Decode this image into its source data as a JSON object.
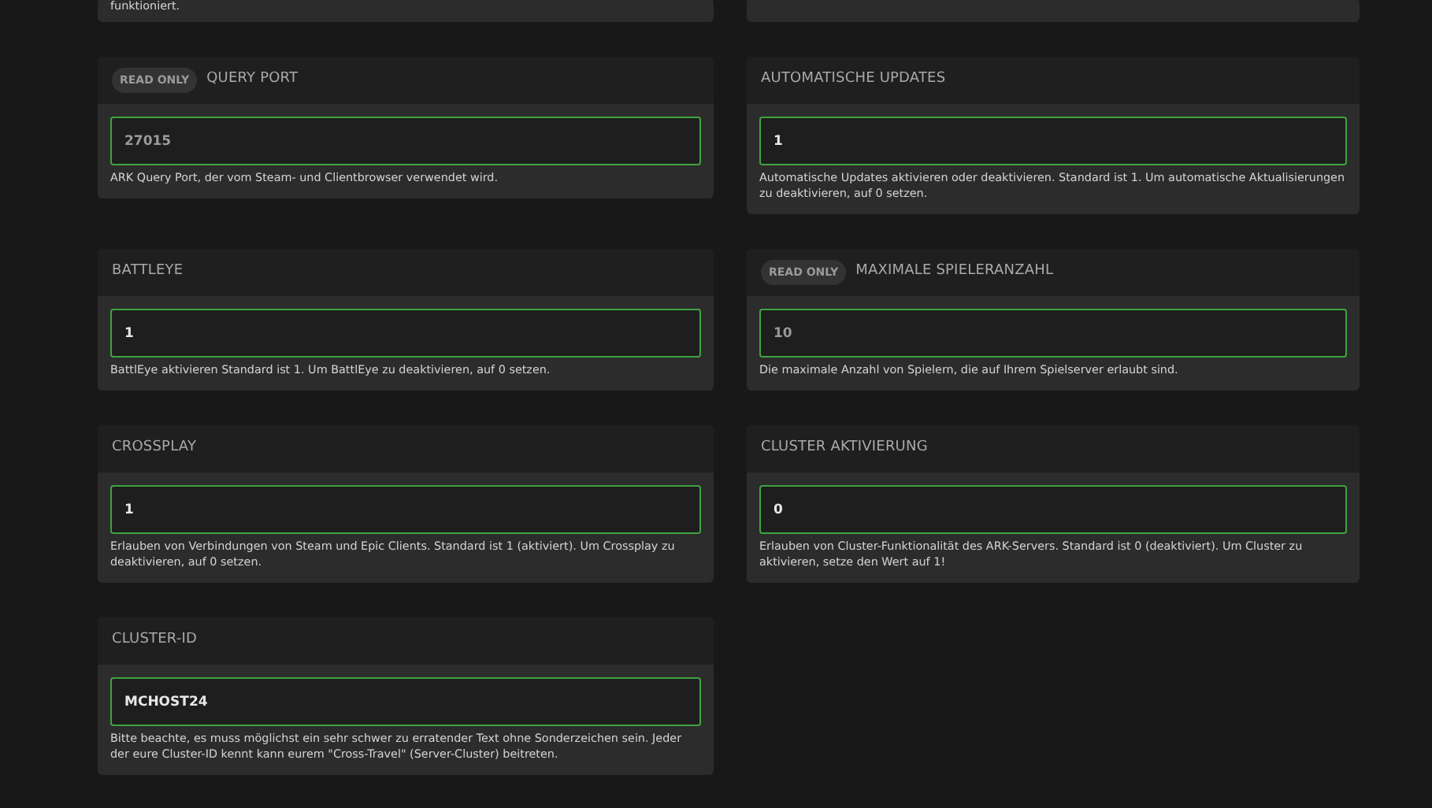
{
  "top_help": "funktioniert.",
  "fields": [
    {
      "label": "QUERY PORT",
      "read_only": true,
      "badge": "READ ONLY",
      "value": "27015",
      "help": "ARK Query Port, der vom Steam- und Clientbrowser verwendet wird."
    },
    {
      "label": "AUTOMATISCHE UPDATES",
      "read_only": false,
      "value": "1",
      "help": "Automatische Updates aktivieren oder deaktivieren. Standard ist 1. Um automatische Aktualisierungen zu deaktivieren, auf 0 setzen."
    },
    {
      "label": "BATTLEYE",
      "read_only": false,
      "value": "1",
      "help": "BattlEye aktivieren Standard ist 1. Um BattlEye zu deaktivieren, auf 0 setzen."
    },
    {
      "label": "MAXIMALE SPIELERANZAHL",
      "read_only": true,
      "badge": "READ ONLY",
      "value": "10",
      "help": "Die maximale Anzahl von Spielern, die auf Ihrem Spielserver erlaubt sind."
    },
    {
      "label": "CROSSPLAY",
      "read_only": false,
      "value": "1",
      "help": "Erlauben von Verbindungen von Steam und Epic Clients. Standard ist 1 (aktiviert). Um Crossplay zu deaktivieren, auf 0 setzen."
    },
    {
      "label": "CLUSTER AKTIVIERUNG",
      "read_only": false,
      "value": "0",
      "help": "Erlauben von Cluster-Funktionalität des ARK-Servers. Standard ist 0 (deaktiviert). Um Cluster zu aktivieren, setze den Wert auf 1!"
    },
    {
      "label": "CLUSTER-ID",
      "read_only": false,
      "value": "MCHOST24",
      "help": "Bitte beachte, es muss möglichst ein sehr schwer zu erratender Text ohne Sonderzeichen sein. Jeder der eure Cluster-ID kennt kann eurem \"Cross-Travel\" (Server-Cluster) beitreten."
    }
  ]
}
